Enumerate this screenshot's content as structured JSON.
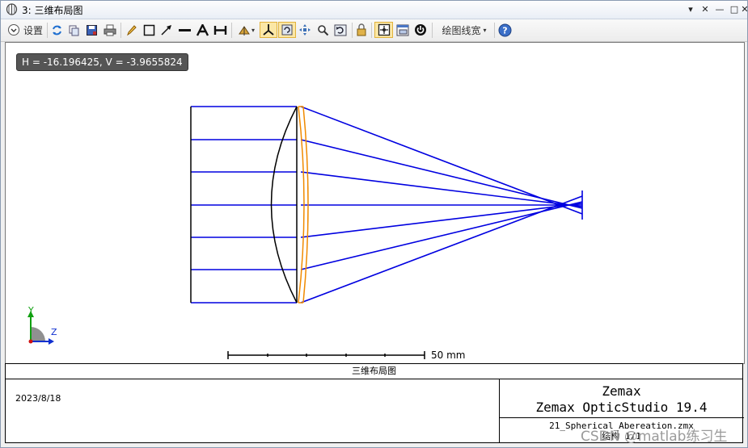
{
  "window": {
    "title": "3: 三维布局图",
    "win_buttons": [
      "▾",
      "✕",
      "—",
      "□",
      "✕"
    ]
  },
  "toolbar": {
    "settings_label": "设置",
    "line_width_label": "绘图线宽"
  },
  "readout": {
    "text": "H = -16.196425, V = -3.9655824"
  },
  "axes": {
    "y_label": "Y",
    "z_label": "Z"
  },
  "scale_bar": {
    "label": "50 mm"
  },
  "footer": {
    "caption": "三维布局图",
    "date": "2023/8/18",
    "company": "Zemax",
    "product": "Zemax OpticStudio 19.4",
    "filename": "21_Spherical_Abereation.zmx",
    "config": "结构 1/1"
  },
  "watermark": "CSDN @matlab练习生",
  "colors": {
    "rays": "#0000e0",
    "lens": "#000000",
    "orange_surface": "#f08a00"
  }
}
